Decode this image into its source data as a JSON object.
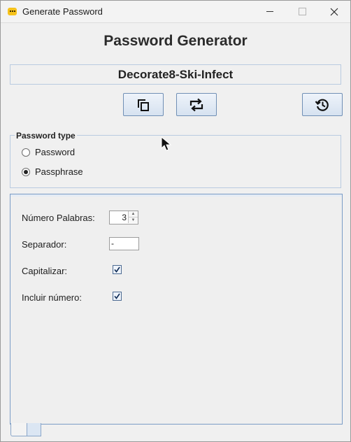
{
  "window": {
    "title": "Generate Password",
    "controls": [
      "minimize",
      "maximize",
      "close"
    ]
  },
  "main": {
    "heading": "Password Generator",
    "password_value": "Decorate8-Ski-Infect",
    "toolbar": [
      {
        "name": "copy",
        "icon": "copy-icon"
      },
      {
        "name": "regenerate",
        "icon": "refresh-icon"
      },
      {
        "name": "history",
        "icon": "history-icon"
      }
    ]
  },
  "password_type": {
    "legend": "Password type",
    "options": [
      {
        "label": "Password",
        "selected": false
      },
      {
        "label": "Passphrase",
        "selected": true
      }
    ]
  },
  "options": {
    "word_count_label": "Número Palabras:",
    "word_count_value": "3",
    "separator_label": "Separador:",
    "separator_value": "-",
    "capitalize_label": "Capitalizar:",
    "capitalize_checked": true,
    "include_number_label": "Incluir número:",
    "include_number_checked": true
  },
  "colors": {
    "button_border": "#708fb5",
    "group_border": "#b9cbe0",
    "panel_border": "#7a9cc6",
    "app_icon": "#f6c21b"
  }
}
